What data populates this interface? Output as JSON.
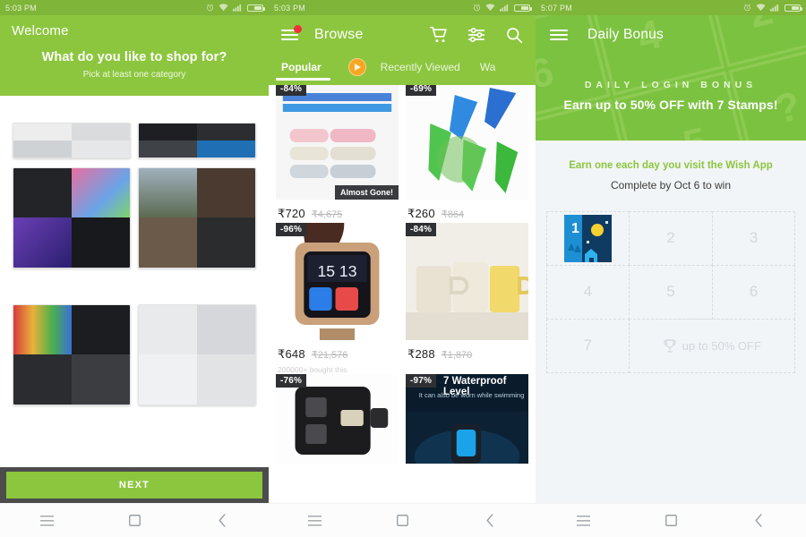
{
  "panels": [
    {
      "status": {
        "time": "5:03 PM",
        "icons": [
          "alarm-icon",
          "wifi-icon",
          "signal-icon",
          "battery-icon"
        ]
      },
      "header": {
        "welcome": "Welcome",
        "question": "What do you like to shop for?",
        "subtitle": "Pick at least one category"
      },
      "categories": [
        {
          "name": "category-electronics"
        },
        {
          "name": "category-usb-storage"
        },
        {
          "name": "category-computer-peripherals"
        },
        {
          "name": "category-outdoor-watches"
        },
        {
          "name": "category-stationery-gadgets"
        },
        {
          "name": "category-phone-accessories"
        },
        {
          "name": "category-binoculars-optics"
        },
        {
          "name": "category-laser-lighting"
        }
      ],
      "next_label": "NEXT"
    },
    {
      "status": {
        "time": "5:03 PM"
      },
      "header": {
        "title": "Browse",
        "menu_badge": true
      },
      "actions": [
        "cart-icon",
        "filter-icon",
        "search-icon"
      ],
      "tabs": [
        {
          "label": "Popular",
          "active": true
        },
        {
          "label": "Recently Viewed",
          "active": false
        },
        {
          "label": "Wa",
          "active": false
        }
      ],
      "products": [
        {
          "discount": "-84%",
          "price": "₹720",
          "price_old": "₹4,675",
          "tag": "Almost Gone!",
          "bought": "",
          "name": "product-lightning-cables"
        },
        {
          "discount": "-69%",
          "price": "₹260",
          "price_old": "₹864",
          "tag": "",
          "bought": "",
          "name": "product-watering-spikes"
        },
        {
          "discount": "-96%",
          "price": "₹648",
          "price_old": "₹21,576",
          "tag": "",
          "bought": "200000+ bought this",
          "name": "product-smart-watch"
        },
        {
          "discount": "-84%",
          "price": "₹288",
          "price_old": "₹1,870",
          "tag": "",
          "bought": "",
          "name": "product-ceramic-mugs"
        },
        {
          "discount": "-76%",
          "price": "",
          "price_old": "",
          "tag": "",
          "bought": "",
          "name": "product-car-usb-charger"
        },
        {
          "discount": "-97%",
          "price": "",
          "price_old": "",
          "tag": "",
          "bought": "",
          "name": "product-fitness-band",
          "overlay_title": "7 Waterproof Level",
          "overlay_sub": "It can also be worn while swimming"
        }
      ]
    },
    {
      "status": {
        "time": "5:07 PM"
      },
      "header": {
        "title": "Daily Bonus"
      },
      "hero": {
        "kicker": "DAILY LOGIN BONUS",
        "headline": "Earn up to 50% OFF with 7 Stamps!"
      },
      "body": {
        "line1": "Earn one each day you visit the Wish App",
        "line2": "Complete by Oct 6 to win"
      },
      "stamps": [
        {
          "label": "1",
          "state": "collected"
        },
        {
          "label": "2",
          "state": "empty"
        },
        {
          "label": "3",
          "state": "empty"
        },
        {
          "label": "4",
          "state": "empty"
        },
        {
          "label": "5",
          "state": "empty"
        },
        {
          "label": "6",
          "state": "empty"
        },
        {
          "label": "7",
          "state": "empty"
        }
      ],
      "prize_label": "up to 50% OFF"
    }
  ],
  "navbar": {
    "buttons": [
      "menu-icon",
      "home-icon",
      "back-icon"
    ]
  },
  "colors": {
    "brand_green": "#8cc63e",
    "status_green": "#7fb539",
    "badge_red": "#ef2f3c",
    "badge_orange": "#f5a623",
    "discount_dark": "#2f3033",
    "next_bar": "#4c4c4c",
    "panel3_bg": "#f2f5f7"
  }
}
